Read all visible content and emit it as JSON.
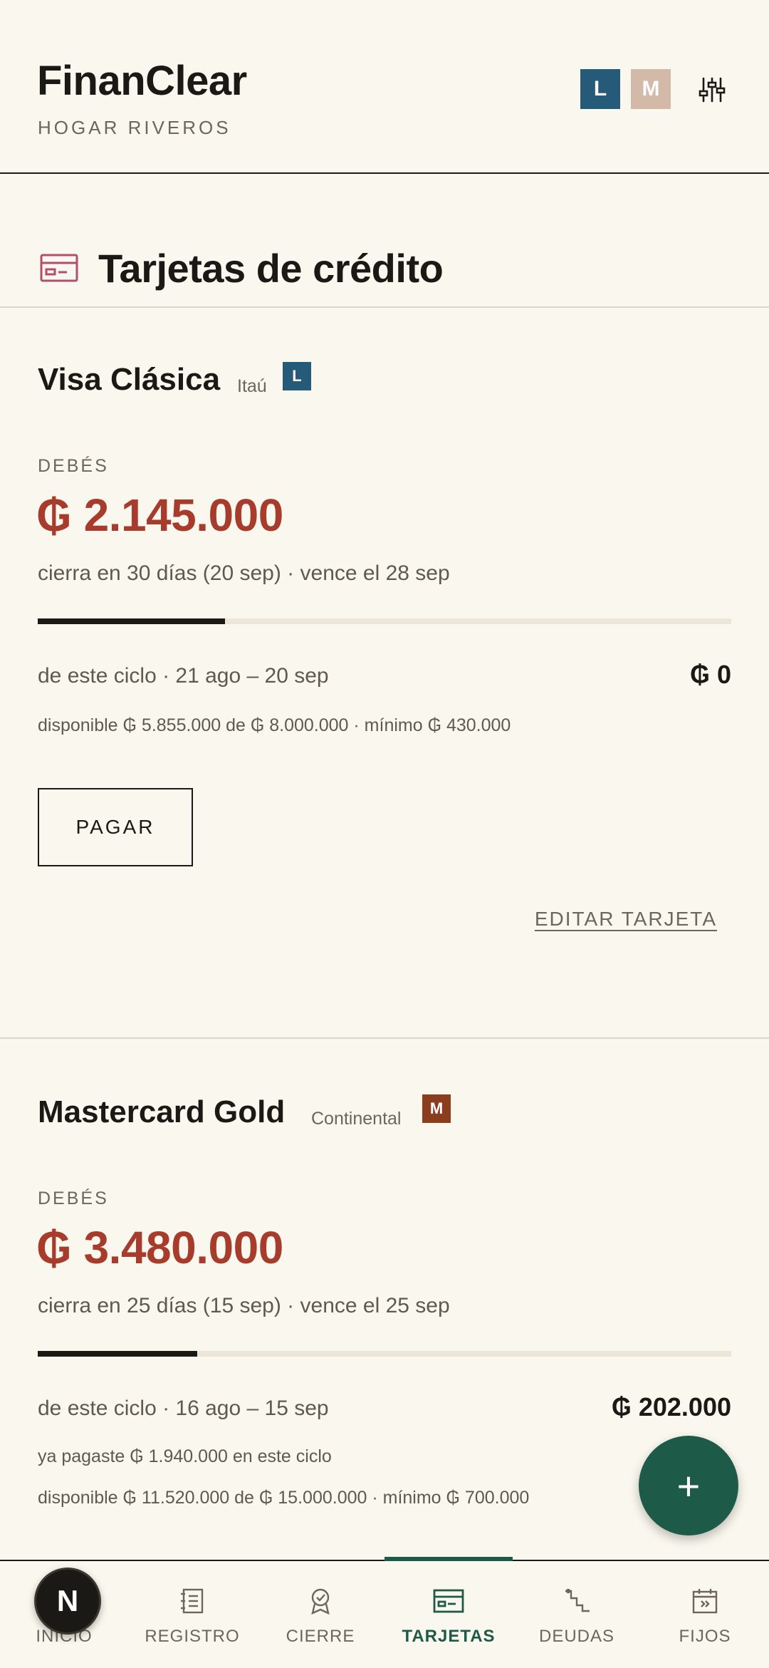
{
  "header": {
    "app_title": "FinanClear",
    "household": "HOGAR RIVEROS",
    "users": [
      {
        "initial": "L",
        "color": "#255A78"
      },
      {
        "initial": "M",
        "color": "#D3B9A8"
      }
    ],
    "settings_icon": "sliders-icon"
  },
  "section": {
    "title": "Tarjetas de crédito",
    "icon": "credit-card-icon",
    "icon_color": "#B0506B"
  },
  "cards": [
    {
      "name": "Visa Clásica",
      "bank": "Itaú",
      "owner": "L",
      "owner_color": "#255A78",
      "debt_label": "DEBÉS",
      "debt": "₲ 2.145.000",
      "cycle_info": "cierra en 30 días (20 sep) · vence el 28 sep",
      "progress": 0.27,
      "period_label": "de este ciclo · 21 ago – 20 sep",
      "period_amount": "₲ 0",
      "available": "disponible ₲ 5.855.000 de ₲ 8.000.000 · mínimo ₲ 430.000",
      "pay_label": "PAGAR",
      "edit_label": "EDITAR TARJETA"
    },
    {
      "name": "Mastercard Gold",
      "bank": "Continental",
      "owner": "M",
      "owner_color": "#8A3E1E",
      "debt_label": "DEBÉS",
      "debt": "₲ 3.480.000",
      "cycle_info": "cierra en 25 días (15 sep) · vence el 25 sep",
      "progress": 0.23,
      "period_label": "de este ciclo · 16 ago – 15 sep",
      "period_amount": "₲ 202.000",
      "paid_note": "ya pagaste ₲ 1.940.000 en este ciclo",
      "available": "disponible ₲ 11.520.000 de ₲ 15.000.000 · mínimo ₲ 700.000"
    }
  ],
  "fab": {
    "label": "+"
  },
  "nav": {
    "items": [
      {
        "label": "INICIO",
        "icon": "home-icon"
      },
      {
        "label": "REGISTRO",
        "icon": "ledger-icon"
      },
      {
        "label": "CIERRE",
        "icon": "badge-icon"
      },
      {
        "label": "TARJETAS",
        "icon": "credit-card-icon"
      },
      {
        "label": "DEUDAS",
        "icon": "stairs-icon"
      },
      {
        "label": "FIJOS",
        "icon": "calendar-icon"
      }
    ],
    "active": "TARJETAS",
    "active_color": "#1E5A48"
  },
  "dev_indicator": {
    "label": "N"
  }
}
